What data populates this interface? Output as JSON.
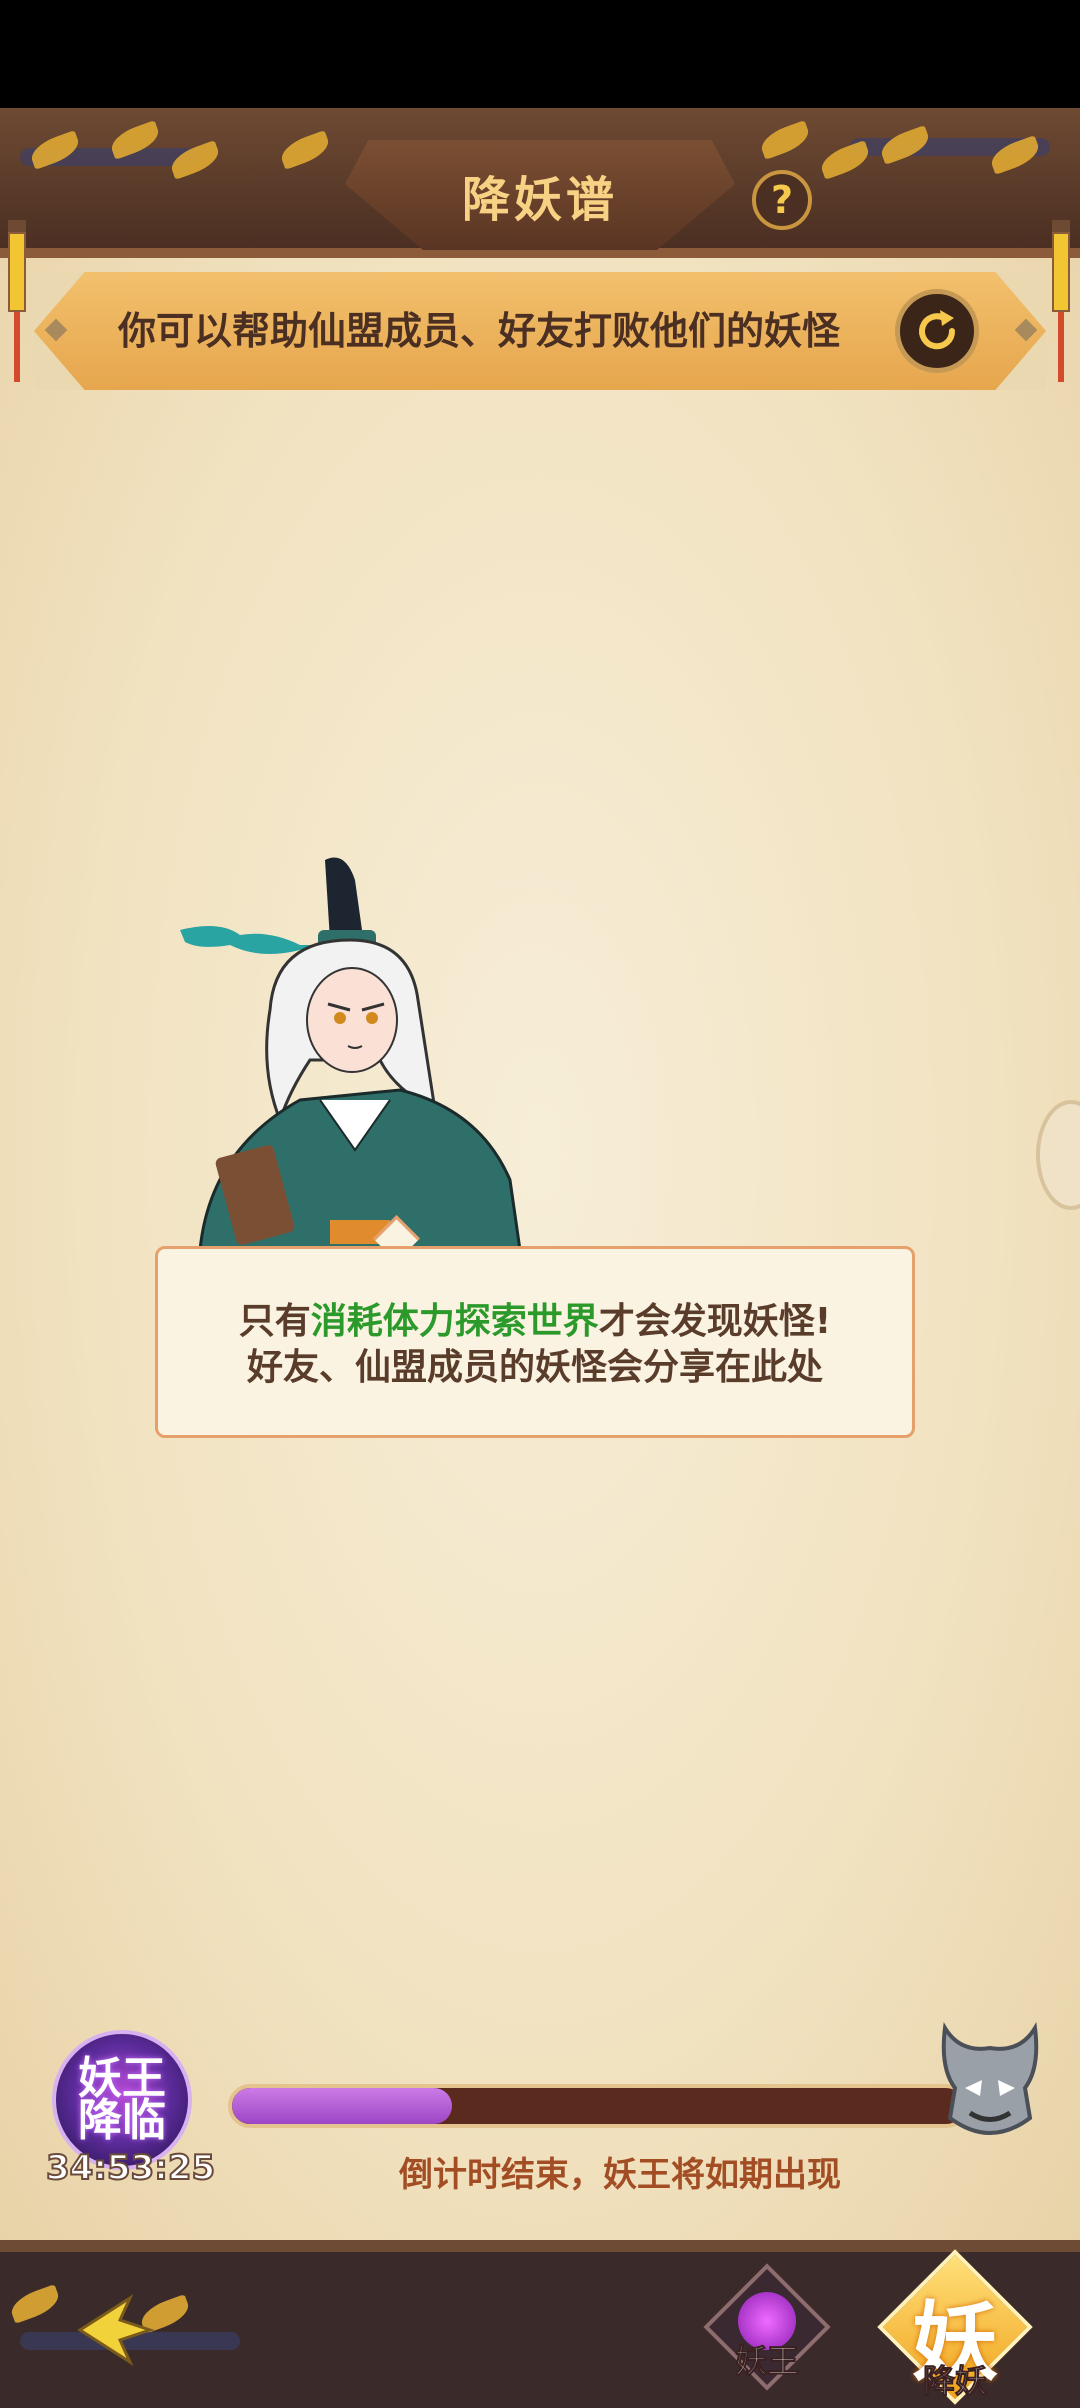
{
  "header": {
    "title": "降妖谱",
    "help_glyph": "?"
  },
  "banner": {
    "text": "你可以帮助仙盟成员、好友打败他们的妖怪"
  },
  "speech": {
    "line1_pre": "只有",
    "line1_highlight": "消耗体力探索世界",
    "line1_post": "才会发现妖怪!",
    "line2": "好友、仙盟成员的妖怪会分享在此处"
  },
  "boss": {
    "badge_text": "妖王降临",
    "timer": "34:53:25",
    "progress": 0.3,
    "countdown_text": "倒计时结束，妖王将如期出现"
  },
  "footer": {
    "tabs": [
      {
        "label": "妖王"
      },
      {
        "label": "降妖",
        "glyph": "妖"
      }
    ]
  },
  "colors": {
    "highlight": "#2b9a2b",
    "progress_fill": "#9c46c6",
    "countdown": "#a24d24"
  }
}
